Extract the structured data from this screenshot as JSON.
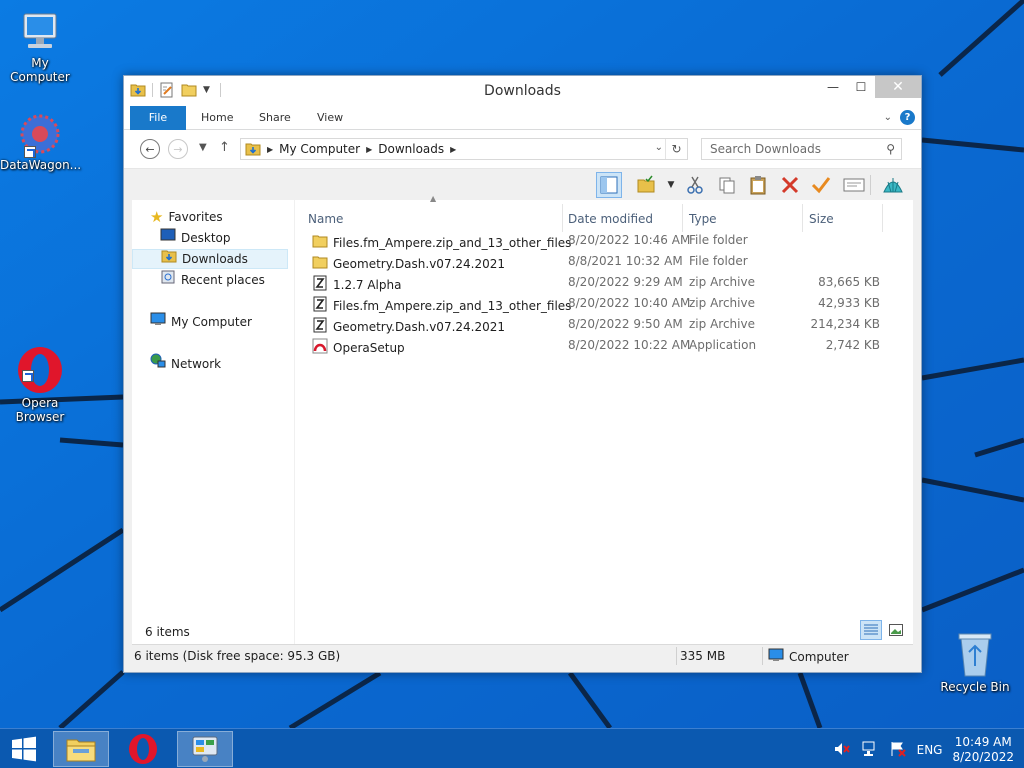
{
  "desktop": {
    "icons": [
      {
        "label": "My Computer",
        "icon": "computer-icon"
      },
      {
        "label": "DataWagon...",
        "icon": "datawagon-icon"
      },
      {
        "label": "Opera\nBrowser",
        "icon": "opera-icon"
      },
      {
        "label": "Recycle Bin",
        "icon": "recycle-bin-icon"
      }
    ],
    "wallpaper_color": "#0a6fd6"
  },
  "window": {
    "title": "Downloads",
    "controls": {
      "minimize": "—",
      "maximize": "☐",
      "close": "✕"
    },
    "ribbon_tabs": [
      "File",
      "Home",
      "Share",
      "View"
    ],
    "accent": "#1979ca",
    "help": "?",
    "address": {
      "crumbs": [
        "My Computer",
        "Downloads"
      ]
    },
    "search": {
      "placeholder": "Search Downloads"
    },
    "columns": [
      "Name",
      "Date modified",
      "Type",
      "Size"
    ],
    "nav_pane": {
      "favorites": "Favorites",
      "desktop": "Desktop",
      "downloads": "Downloads",
      "recent": "Recent places",
      "computer": "My Computer",
      "network": "Network"
    },
    "files": [
      {
        "name": "Files.fm_Ampere.zip_and_13_other_files",
        "date": "8/20/2022 10:46 AM",
        "type": "File folder",
        "size": "",
        "icon": "folder-icon"
      },
      {
        "name": "Geometry.Dash.v07.24.2021",
        "date": "8/8/2021 10:32 AM",
        "type": "File folder",
        "size": "",
        "icon": "folder-icon"
      },
      {
        "name": "1.2.7 Alpha",
        "date": "8/20/2022 9:29 AM",
        "type": "zip Archive",
        "size": "83,665 KB",
        "icon": "zip-icon"
      },
      {
        "name": "Files.fm_Ampere.zip_and_13_other_files",
        "date": "8/20/2022 10:40 AM",
        "type": "zip Archive",
        "size": "42,933 KB",
        "icon": "zip-icon"
      },
      {
        "name": "Geometry.Dash.v07.24.2021",
        "date": "8/20/2022 9:50 AM",
        "type": "zip Archive",
        "size": "214,234 KB",
        "icon": "zip-icon"
      },
      {
        "name": "OperaSetup",
        "date": "8/20/2022 10:22 AM",
        "type": "Application",
        "size": "2,742 KB",
        "icon": "opera-setup-icon"
      }
    ],
    "item_count": "6 items",
    "status": {
      "left": "6 items (Disk free space: 95.3 GB)",
      "size": "335 MB",
      "location": "Computer"
    }
  },
  "taskbar": {
    "tray": {
      "language": "ENG",
      "time": "10:49 AM",
      "date": "8/20/2022"
    }
  }
}
